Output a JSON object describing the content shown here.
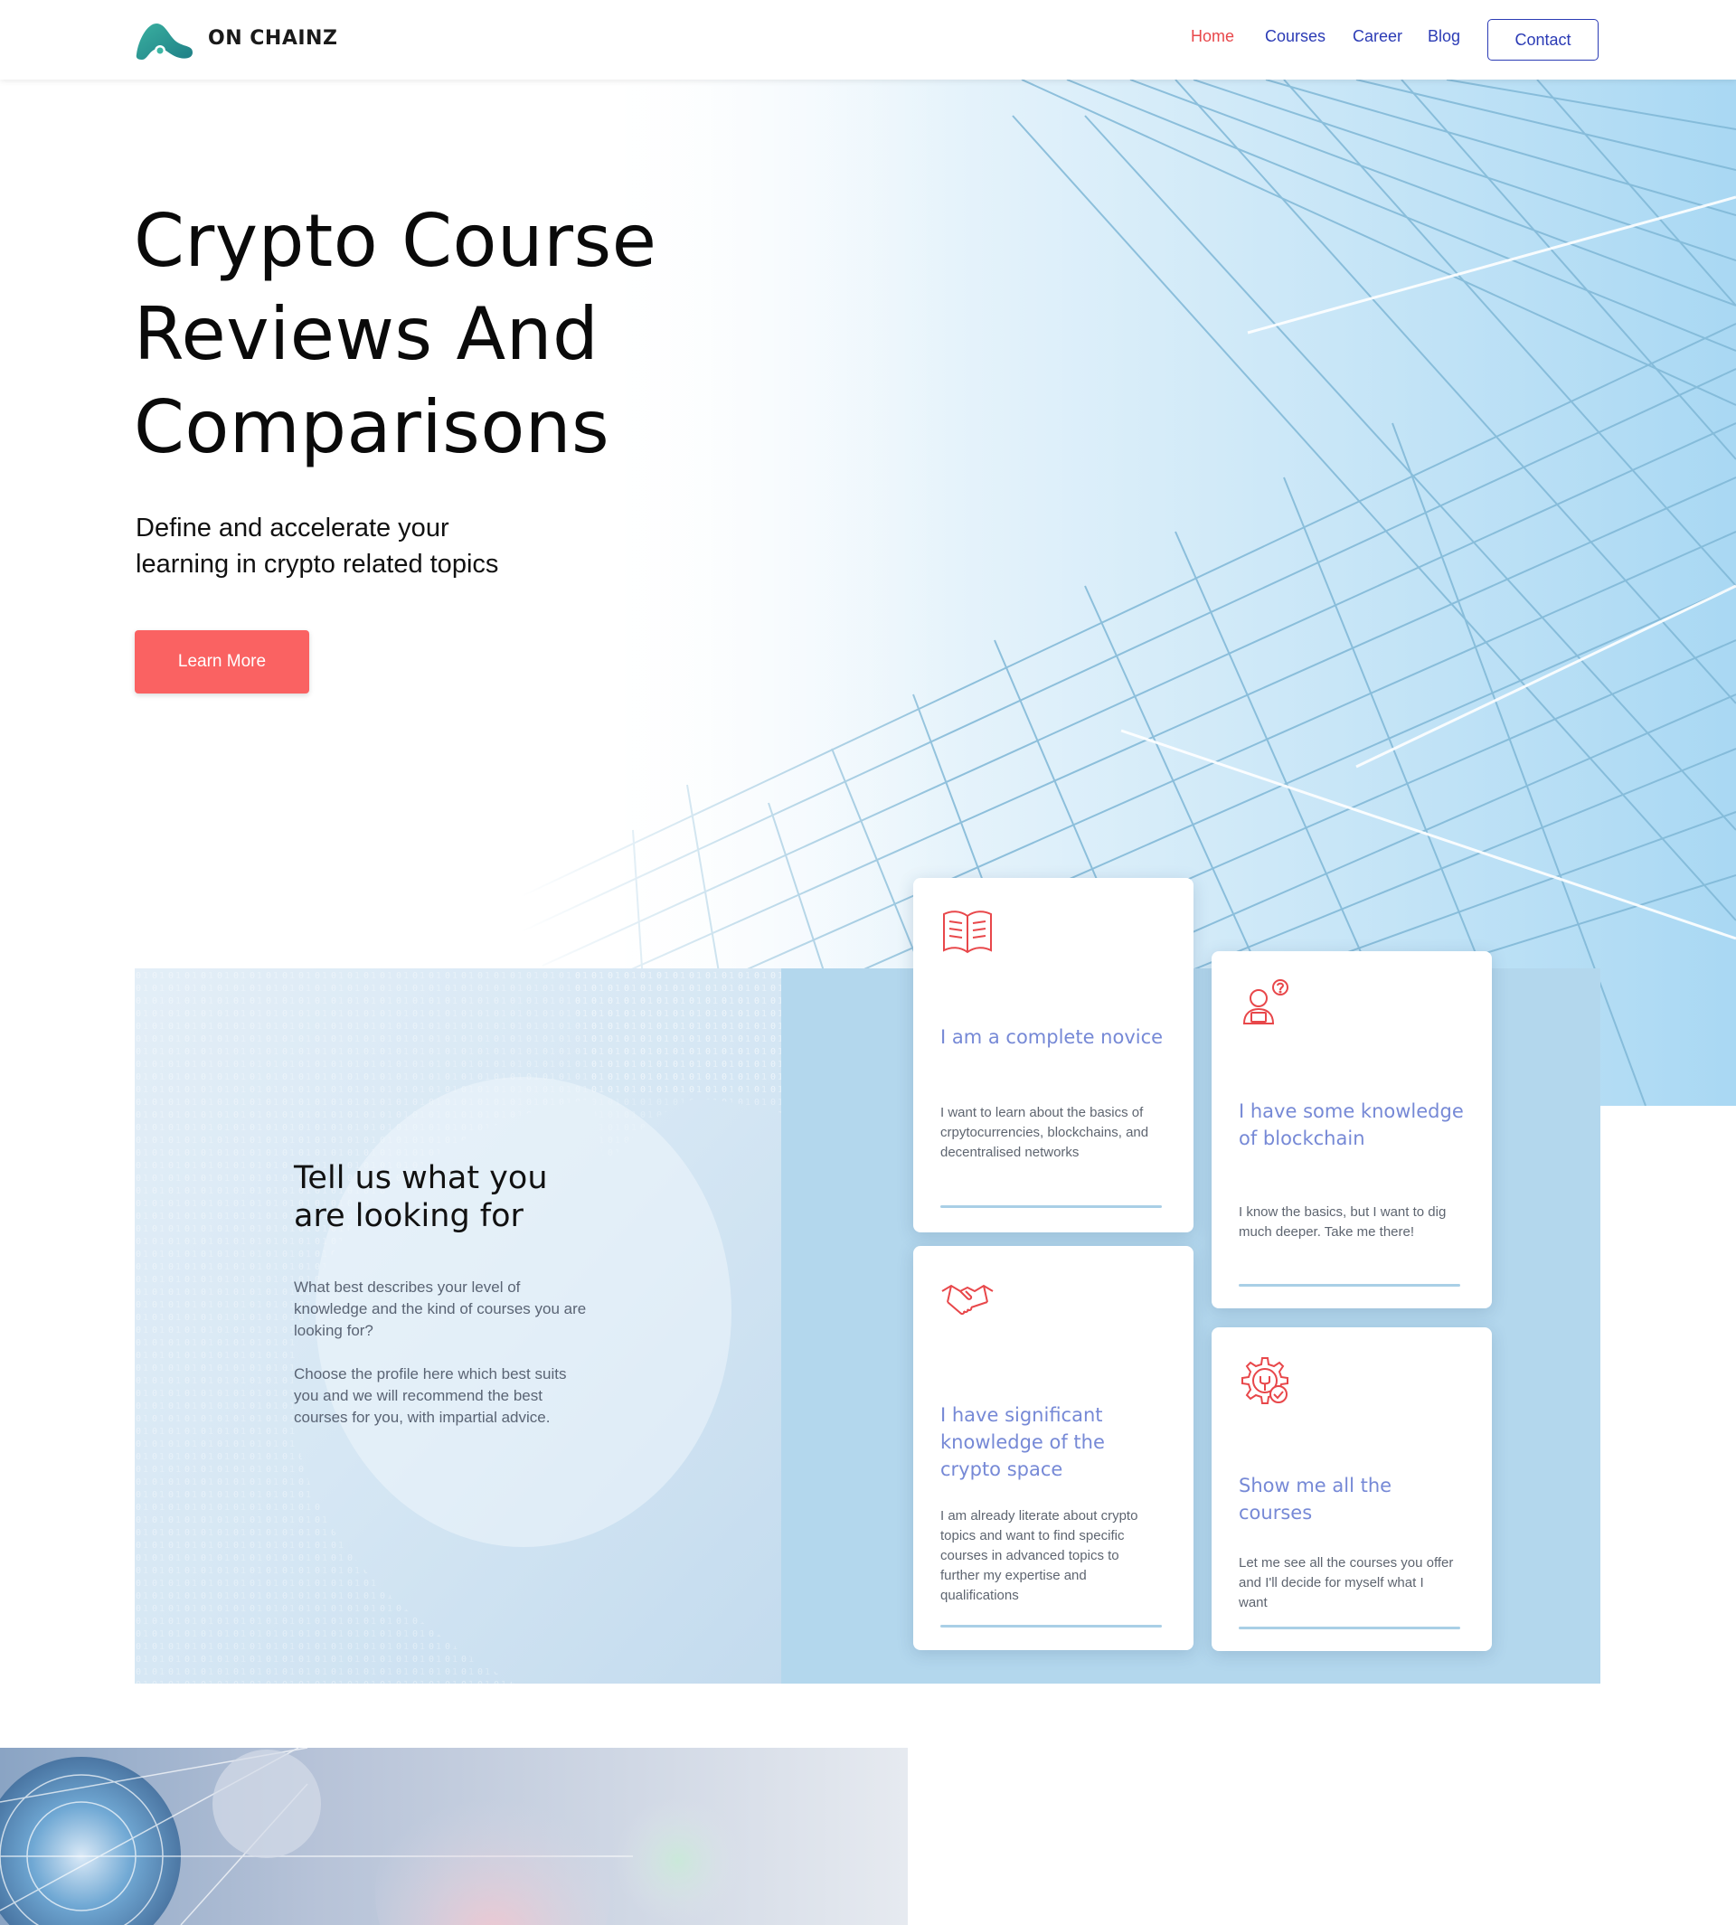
{
  "brand": {
    "name": "ON CHAINZ"
  },
  "nav": {
    "items": [
      {
        "label": "Home",
        "active": true
      },
      {
        "label": "Courses",
        "active": false
      },
      {
        "label": "Career",
        "active": false
      },
      {
        "label": "Blog",
        "active": false
      }
    ],
    "contact_label": "Contact"
  },
  "hero": {
    "title_lines": [
      "Crypto Course",
      "Reviews And",
      "Comparisons"
    ],
    "subtitle_lines": [
      "Define and accelerate your",
      "learning in crypto related topics"
    ],
    "cta_label": "Learn More"
  },
  "profile_section": {
    "title_lines": [
      "Tell us what you",
      "are looking for"
    ],
    "paragraph_1": "What best describes your level of knowledge and the kind of courses you are looking for?",
    "paragraph_2": "Choose the profile here which best suits you and we will recommend the best courses for you, with impartial advice.",
    "cards": [
      {
        "icon": "open-book-icon",
        "title": "I am a complete novice",
        "text": "I want to learn about the basics of crpytocurrencies, blockchains, and decentralised networks"
      },
      {
        "icon": "person-question-icon",
        "title": "I have some knowledge of blockchain",
        "text": "I know the basics, but I want to dig much deeper. Take me there!"
      },
      {
        "icon": "handshake-icon",
        "title": "I have significant knowledge of the crypto space",
        "text": "I am already literate about crypto topics and want to find specific courses in advanced topics to further my expertise and qualifications"
      },
      {
        "icon": "gear-check-icon",
        "title": "Show me all the courses",
        "text": "Let me see all the courses you offer and I'll decide for myself what I want"
      }
    ]
  },
  "colors": {
    "accent_red": "#fa6262",
    "nav_blue": "#2b3bb5",
    "card_title": "#7689d6",
    "panel_blue": "#b3d7ed",
    "icon_red": "#e8474a"
  }
}
